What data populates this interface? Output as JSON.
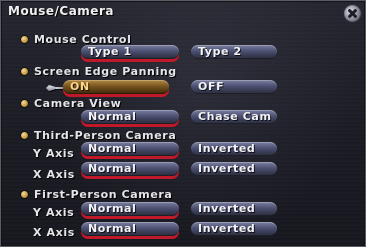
{
  "window": {
    "title": "Mouse/Camera",
    "close_icon": "close-icon"
  },
  "sections": {
    "mouse_control": {
      "label": "Mouse Control"
    },
    "screen_edge_panning": {
      "label": "Screen Edge Panning"
    },
    "camera_view": {
      "label": "Camera View"
    },
    "third_person_camera": {
      "label": "Third-Person Camera"
    },
    "first_person_camera": {
      "label": "First-Person Camera"
    }
  },
  "axis_labels": {
    "y_axis": "Y Axis",
    "x_axis": "X Axis"
  },
  "options": {
    "mouse_control": [
      {
        "label": "Type 1",
        "selected": true
      },
      {
        "label": "Type 2",
        "selected": false
      }
    ],
    "screen_edge_panning": [
      {
        "label": "ON",
        "selected": true,
        "focused": true
      },
      {
        "label": "OFF",
        "selected": false
      }
    ],
    "camera_view": [
      {
        "label": "Normal",
        "selected": true
      },
      {
        "label": "Chase Cam",
        "selected": false
      }
    ],
    "third_person": {
      "y_axis": [
        {
          "label": "Normal",
          "selected": true
        },
        {
          "label": "Inverted",
          "selected": false
        }
      ],
      "x_axis": [
        {
          "label": "Normal",
          "selected": true
        },
        {
          "label": "Inverted",
          "selected": false
        }
      ]
    },
    "first_person": {
      "y_axis": [
        {
          "label": "Normal",
          "selected": true
        },
        {
          "label": "Inverted",
          "selected": false
        }
      ],
      "x_axis": [
        {
          "label": "Normal",
          "selected": true
        },
        {
          "label": "Inverted",
          "selected": false
        }
      ]
    }
  },
  "colors": {
    "accent_selected_underline": "#c01a2a",
    "button_blue_top": "#7c80a0",
    "button_blue_bottom": "#2a2c3a",
    "button_on_top": "#b38a42",
    "button_on_text": "#ffd58a",
    "bullet_gold": "#c79c46",
    "panel_bg": "#1b1b24",
    "panel_border": "#5b5c66"
  },
  "cursor_icon": "arrow-cursor-icon"
}
